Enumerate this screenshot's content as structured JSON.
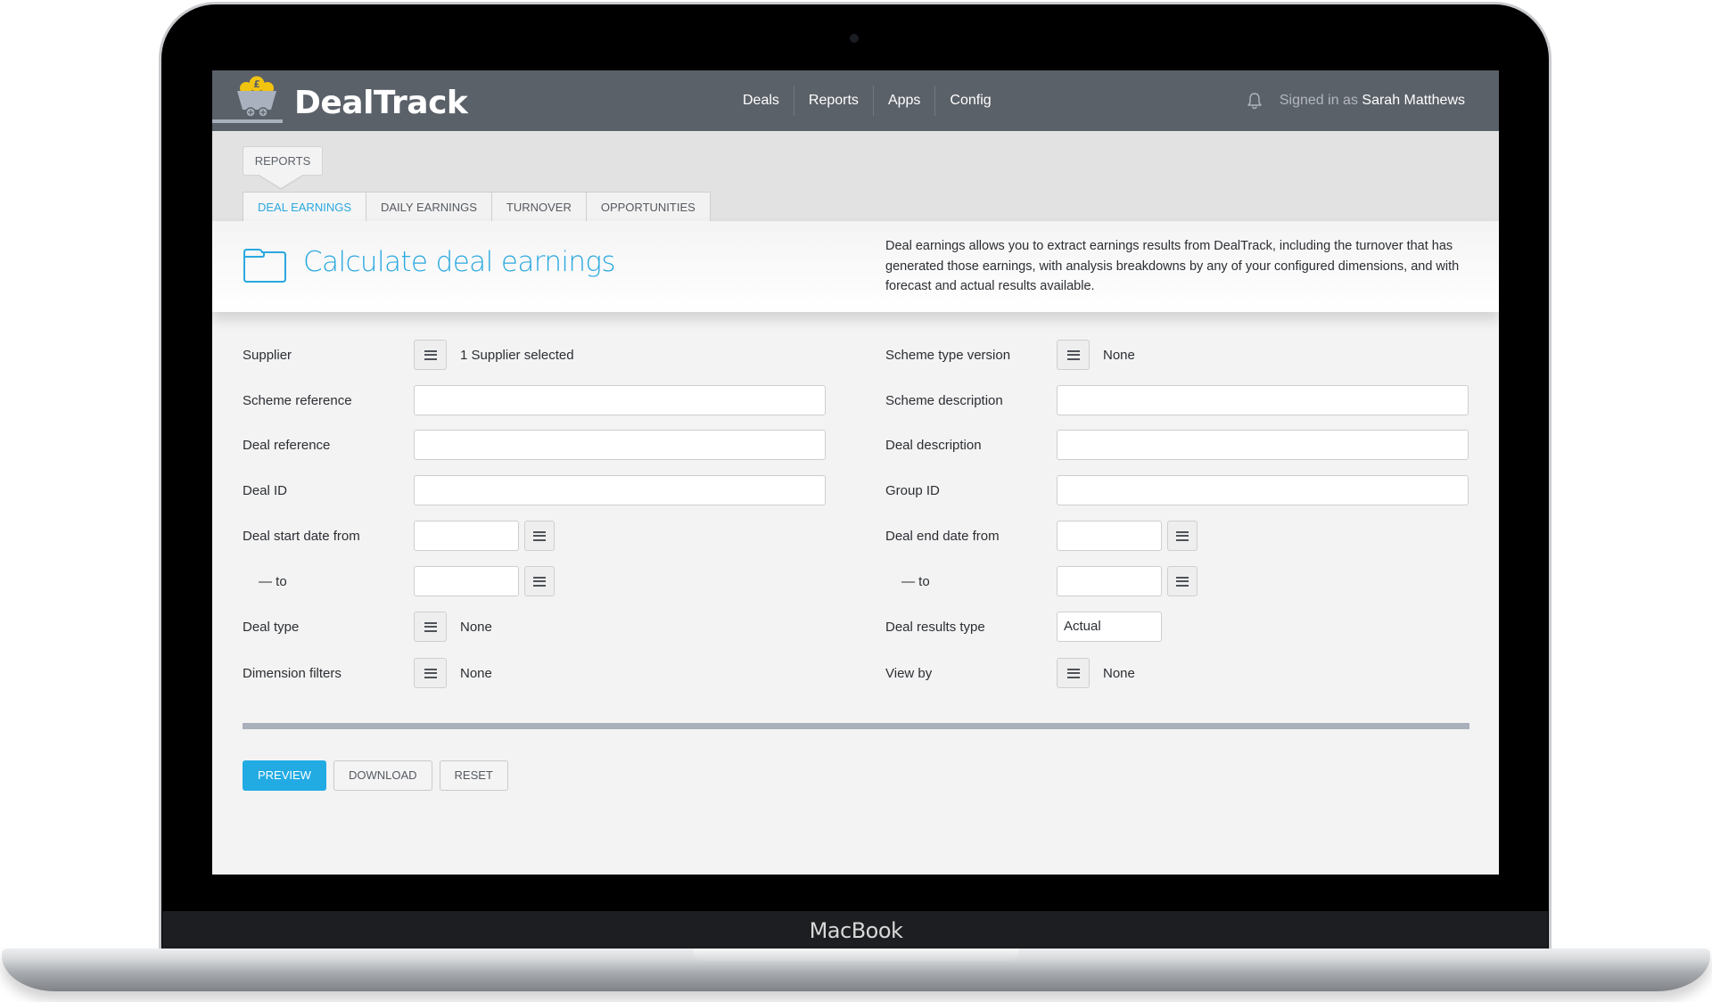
{
  "device": {
    "brand_label": "MacBook"
  },
  "app": {
    "name": "DealTrack",
    "brand_colors": {
      "header": "#5b6169",
      "accent": "#2aa8df",
      "primary_button": "#22abe3",
      "coin": "#f2c40f"
    }
  },
  "header": {
    "nav": [
      {
        "label": "Deals"
      },
      {
        "label": "Reports"
      },
      {
        "label": "Apps"
      },
      {
        "label": "Config"
      }
    ],
    "notification_icon": "bell-icon",
    "signed_in_prefix": "Signed in as",
    "user_name": "Sarah Matthews"
  },
  "section": {
    "label": "REPORTS",
    "tabs": [
      {
        "label": "DEAL EARNINGS",
        "active": true
      },
      {
        "label": "DAILY EARNINGS",
        "active": false
      },
      {
        "label": "TURNOVER",
        "active": false
      },
      {
        "label": "OPPORTUNITIES",
        "active": false
      }
    ]
  },
  "page": {
    "icon": "folder-icon",
    "title": "Calculate deal earnings",
    "description": "Deal earnings allows you to extract earnings results from DealTrack, including the turnover that has generated those earnings, with analysis breakdowns by any of your configured dimensions, and with forecast and actual results available."
  },
  "form": {
    "left": {
      "supplier": {
        "label": "Supplier",
        "value": "1 Supplier selected"
      },
      "scheme_reference": {
        "label": "Scheme reference",
        "value": ""
      },
      "deal_reference": {
        "label": "Deal reference",
        "value": ""
      },
      "deal_id": {
        "label": "Deal ID",
        "value": ""
      },
      "deal_start_from": {
        "label": "Deal start date from",
        "value": ""
      },
      "deal_start_to": {
        "label": "— to",
        "value": ""
      },
      "deal_type": {
        "label": "Deal type",
        "value": "None"
      },
      "dimension_filters": {
        "label": "Dimension filters",
        "value": "None"
      }
    },
    "right": {
      "scheme_type_version": {
        "label": "Scheme type version",
        "value": "None"
      },
      "scheme_description": {
        "label": "Scheme description",
        "value": ""
      },
      "deal_description": {
        "label": "Deal description",
        "value": ""
      },
      "group_id": {
        "label": "Group ID",
        "value": ""
      },
      "deal_end_from": {
        "label": "Deal end date from",
        "value": ""
      },
      "deal_end_to": {
        "label": "— to",
        "value": ""
      },
      "deal_results_type": {
        "label": "Deal results type",
        "value": "Actual"
      },
      "view_by": {
        "label": "View by",
        "value": "None"
      }
    }
  },
  "actions": {
    "preview": "PREVIEW",
    "download": "DOWNLOAD",
    "reset": "RESET"
  }
}
